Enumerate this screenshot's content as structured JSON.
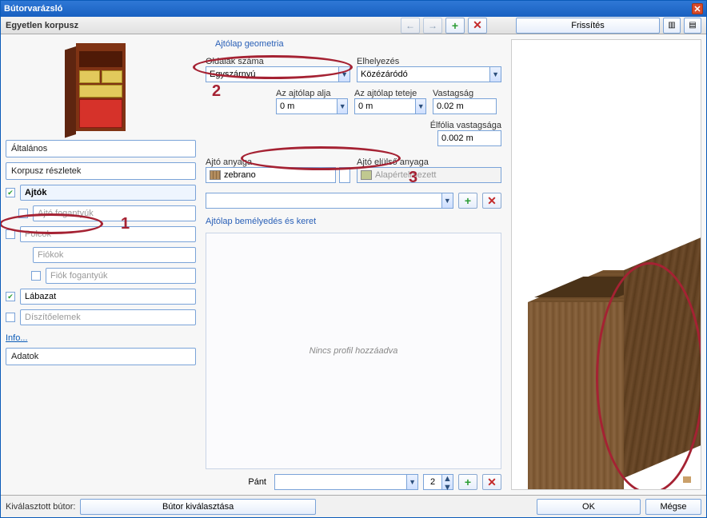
{
  "window": {
    "title": "Bútorvarázsló"
  },
  "toolbar": {
    "subtitle": "Egyetlen korpusz"
  },
  "refresh": {
    "label": "Frissítés"
  },
  "sidebar": {
    "altalanos": "Általános",
    "korpusz": "Korpusz részletek",
    "ajtok": "Ajtók",
    "ajtofog": "Ajtó fogantyúk",
    "polcok": "Polcok",
    "fiokok": "Fiókok",
    "fiokfog": "Fiók fogantyúk",
    "labazat": "Lábazat",
    "diszito": "Díszítőelemek",
    "info": "Info...",
    "adatok": "Adatok"
  },
  "geom": {
    "group": "Ajtólap geometria",
    "oldalak_lbl": "Oldalak száma",
    "oldalak_val": "Egyszárnyú",
    "elhely_lbl": "Elhelyezés",
    "elhely_val": "Közézáródó",
    "alja_lbl": "Az ajtólap alja",
    "alja_val": "0 m",
    "teteje_lbl": "Az ajtólap teteje",
    "teteje_val": "0 m",
    "vastag_lbl": "Vastagság",
    "vastag_val": "0.02 m",
    "elfolia_lbl": "Élfólia vastagsága",
    "elfolia_val": "0.002 m"
  },
  "material": {
    "ajto_lbl": "Ajtó anyaga",
    "ajto_val": "zebrano",
    "front_lbl": "Ajtó elülső anyaga",
    "front_val": "Alapértelmezett"
  },
  "profile": {
    "group": "Ajtólap bemélyedés és keret",
    "empty": "Nincs profil hozzáadva"
  },
  "pant": {
    "label": "Pánt",
    "count": "2"
  },
  "footer": {
    "selected": "Kiválasztott bútor:",
    "pick": "Bútor kiválasztása",
    "ok": "OK",
    "cancel": "Mégse"
  },
  "annotations": {
    "n1": "1",
    "n2": "2",
    "n3": "3"
  },
  "chart_data": null
}
